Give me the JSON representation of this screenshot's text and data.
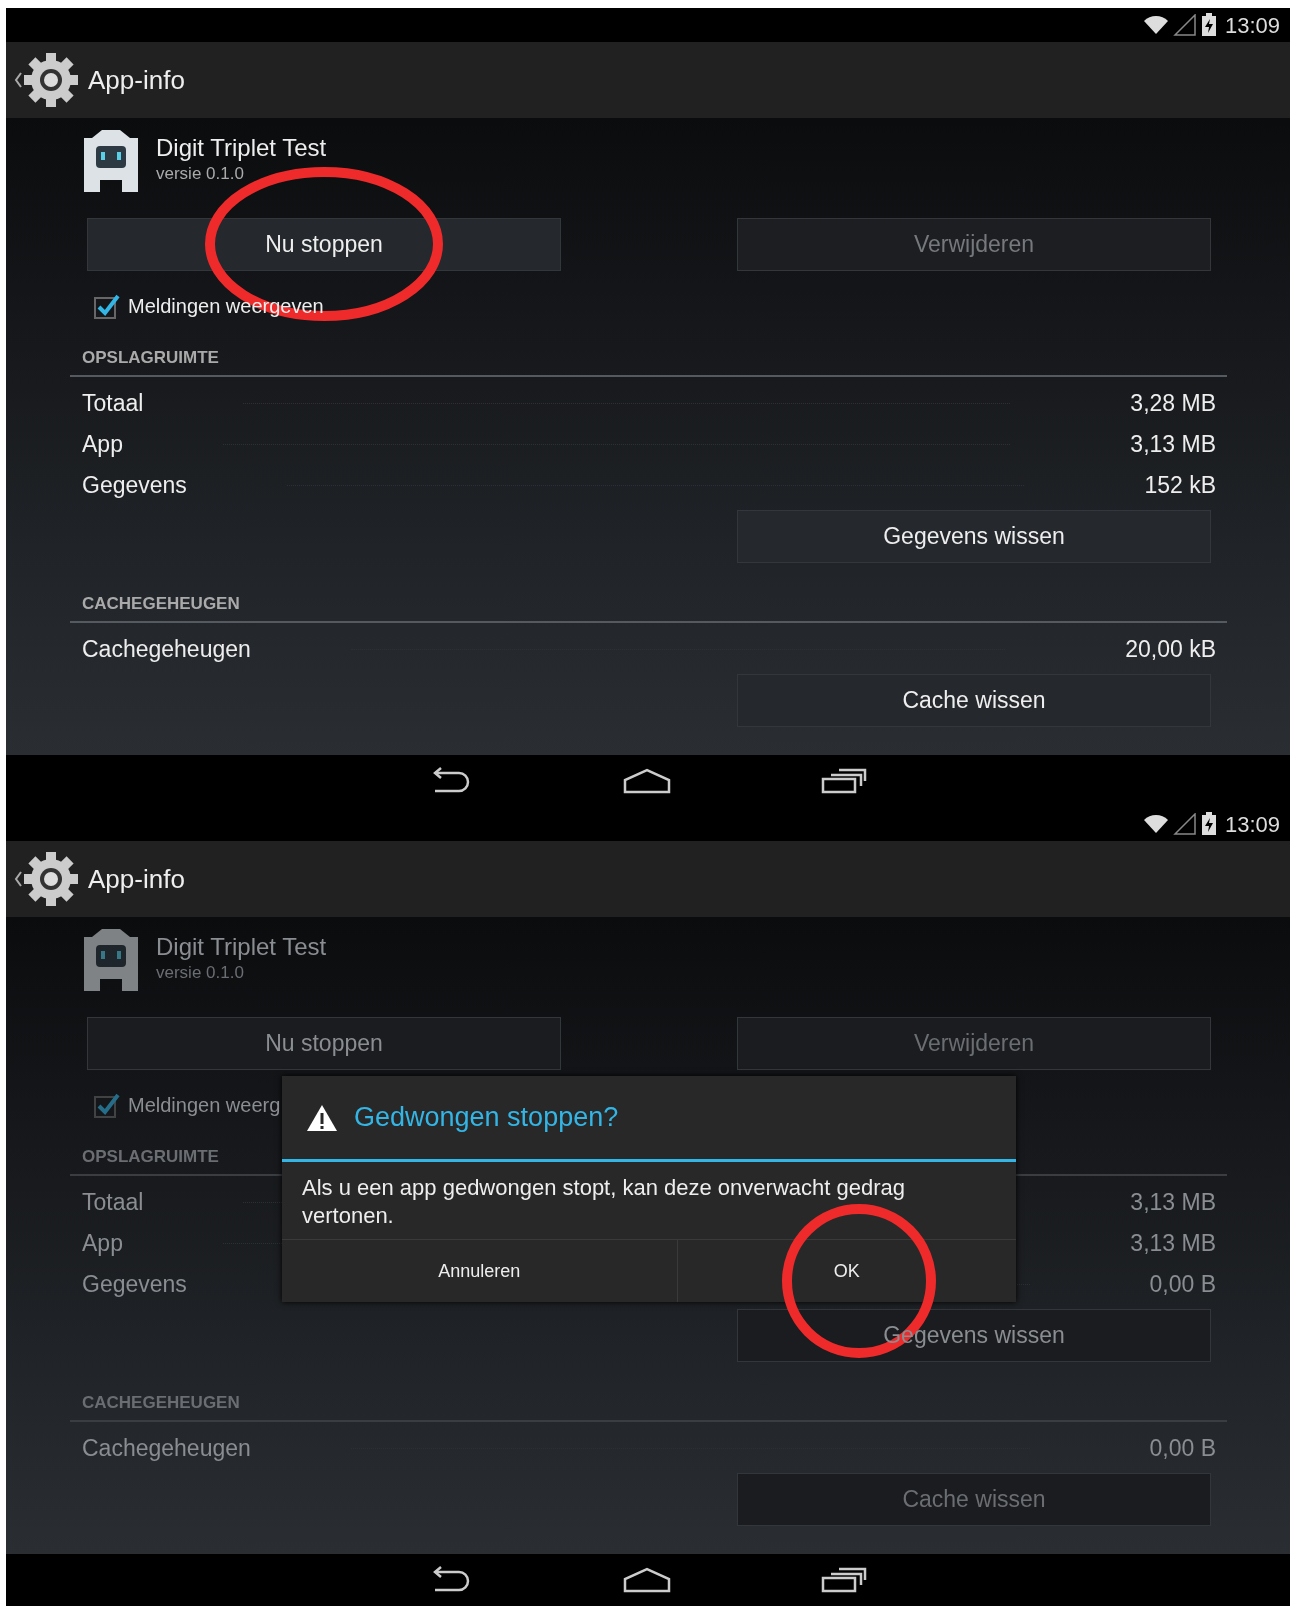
{
  "screens": [
    {
      "status_bar": {
        "time": "13:09"
      },
      "action_bar": {
        "title": "App-info"
      },
      "app": {
        "name": "Digit Triplet Test",
        "version": "versie 0.1.0"
      },
      "buttons": [
        {
          "label": "Nu stoppen",
          "disabled": false,
          "circled": true
        },
        {
          "label": "Verwijderen",
          "disabled": true,
          "circled": false
        }
      ],
      "notifications": {
        "label": "Meldingen weergeven",
        "checked": true
      },
      "sections": [
        {
          "heading": "OPSLAGRUIMTE",
          "rows": [
            {
              "label": "Totaal",
              "value": "3,28 MB"
            },
            {
              "label": "App",
              "value": "3,13 MB"
            },
            {
              "label": "Gegevens",
              "value": "152 kB"
            }
          ],
          "button": {
            "label": "Gegevens wissen",
            "disabled": false
          }
        },
        {
          "heading": "CACHEGEHEUGEN",
          "rows": [
            {
              "label": "Cachegeheugen",
              "value": "20,00 kB"
            }
          ],
          "button": {
            "label": "Cache wissen",
            "disabled": false
          }
        }
      ],
      "dimmed": false
    },
    {
      "status_bar": {
        "time": "13:09"
      },
      "action_bar": {
        "title": "App-info"
      },
      "app": {
        "name": "Digit Triplet Test",
        "version": "versie 0.1.0"
      },
      "buttons": [
        {
          "label": "Nu stoppen",
          "disabled": false,
          "circled": false
        },
        {
          "label": "Verwijderen",
          "disabled": true,
          "circled": false
        }
      ],
      "notifications": {
        "label": "Meldingen weerg",
        "checked": true
      },
      "sections": [
        {
          "heading": "OPSLAGRUIMTE",
          "rows": [
            {
              "label": "Totaal",
              "value": "3,13 MB"
            },
            {
              "label": "App",
              "value": "3,13 MB"
            },
            {
              "label": "Gegevens",
              "value": "0,00 B"
            }
          ],
          "button": {
            "label": "Gegevens wissen",
            "disabled": false
          }
        },
        {
          "heading": "CACHEGEHEUGEN",
          "rows": [
            {
              "label": "Cachegeheugen",
              "value": "0,00 B"
            }
          ],
          "button": {
            "label": "Cache wissen",
            "disabled": true
          }
        }
      ],
      "dimmed": true,
      "dialog": {
        "title": "Gedwongen stoppen?",
        "message": "Als u een app gedwongen stopt, kan deze onverwacht gedrag vertonen.",
        "buttons": [
          {
            "label": "Annuleren",
            "circled": false
          },
          {
            "label": "OK",
            "circled": true
          }
        ]
      }
    }
  ]
}
